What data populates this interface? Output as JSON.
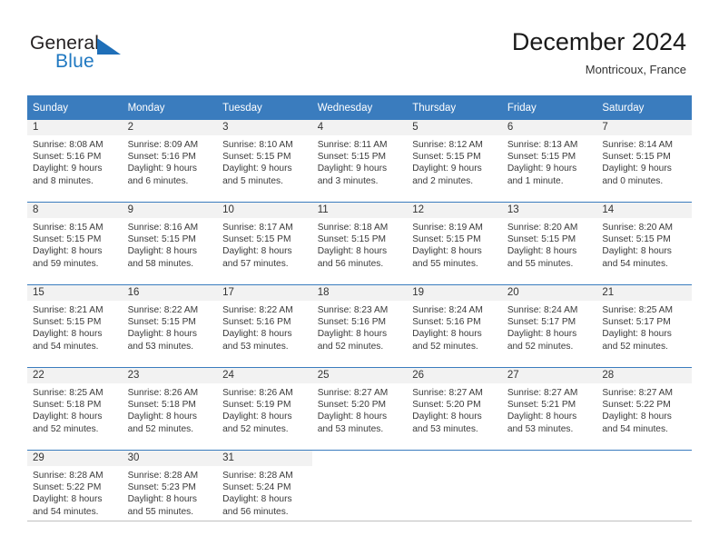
{
  "brand": {
    "name_part1": "General",
    "name_part2": "Blue",
    "mark": "triangle-logo-icon",
    "accent_color": "#1f78c1"
  },
  "header": {
    "month_title": "December 2024",
    "location": "Montricoux, France"
  },
  "theme": {
    "header_row_bg": "#3a7cbe",
    "daynum_band_bg": "#f2f2f2",
    "rule_color": "#3a7cbe"
  },
  "weekday_headers": [
    "Sunday",
    "Monday",
    "Tuesday",
    "Wednesday",
    "Thursday",
    "Friday",
    "Saturday"
  ],
  "weeks": [
    [
      {
        "day": "1",
        "sunrise": "Sunrise: 8:08 AM",
        "sunset": "Sunset: 5:16 PM",
        "daylight1": "Daylight: 9 hours",
        "daylight2": "and 8 minutes."
      },
      {
        "day": "2",
        "sunrise": "Sunrise: 8:09 AM",
        "sunset": "Sunset: 5:16 PM",
        "daylight1": "Daylight: 9 hours",
        "daylight2": "and 6 minutes."
      },
      {
        "day": "3",
        "sunrise": "Sunrise: 8:10 AM",
        "sunset": "Sunset: 5:15 PM",
        "daylight1": "Daylight: 9 hours",
        "daylight2": "and 5 minutes."
      },
      {
        "day": "4",
        "sunrise": "Sunrise: 8:11 AM",
        "sunset": "Sunset: 5:15 PM",
        "daylight1": "Daylight: 9 hours",
        "daylight2": "and 3 minutes."
      },
      {
        "day": "5",
        "sunrise": "Sunrise: 8:12 AM",
        "sunset": "Sunset: 5:15 PM",
        "daylight1": "Daylight: 9 hours",
        "daylight2": "and 2 minutes."
      },
      {
        "day": "6",
        "sunrise": "Sunrise: 8:13 AM",
        "sunset": "Sunset: 5:15 PM",
        "daylight1": "Daylight: 9 hours",
        "daylight2": "and 1 minute."
      },
      {
        "day": "7",
        "sunrise": "Sunrise: 8:14 AM",
        "sunset": "Sunset: 5:15 PM",
        "daylight1": "Daylight: 9 hours",
        "daylight2": "and 0 minutes."
      }
    ],
    [
      {
        "day": "8",
        "sunrise": "Sunrise: 8:15 AM",
        "sunset": "Sunset: 5:15 PM",
        "daylight1": "Daylight: 8 hours",
        "daylight2": "and 59 minutes."
      },
      {
        "day": "9",
        "sunrise": "Sunrise: 8:16 AM",
        "sunset": "Sunset: 5:15 PM",
        "daylight1": "Daylight: 8 hours",
        "daylight2": "and 58 minutes."
      },
      {
        "day": "10",
        "sunrise": "Sunrise: 8:17 AM",
        "sunset": "Sunset: 5:15 PM",
        "daylight1": "Daylight: 8 hours",
        "daylight2": "and 57 minutes."
      },
      {
        "day": "11",
        "sunrise": "Sunrise: 8:18 AM",
        "sunset": "Sunset: 5:15 PM",
        "daylight1": "Daylight: 8 hours",
        "daylight2": "and 56 minutes."
      },
      {
        "day": "12",
        "sunrise": "Sunrise: 8:19 AM",
        "sunset": "Sunset: 5:15 PM",
        "daylight1": "Daylight: 8 hours",
        "daylight2": "and 55 minutes."
      },
      {
        "day": "13",
        "sunrise": "Sunrise: 8:20 AM",
        "sunset": "Sunset: 5:15 PM",
        "daylight1": "Daylight: 8 hours",
        "daylight2": "and 55 minutes."
      },
      {
        "day": "14",
        "sunrise": "Sunrise: 8:20 AM",
        "sunset": "Sunset: 5:15 PM",
        "daylight1": "Daylight: 8 hours",
        "daylight2": "and 54 minutes."
      }
    ],
    [
      {
        "day": "15",
        "sunrise": "Sunrise: 8:21 AM",
        "sunset": "Sunset: 5:15 PM",
        "daylight1": "Daylight: 8 hours",
        "daylight2": "and 54 minutes."
      },
      {
        "day": "16",
        "sunrise": "Sunrise: 8:22 AM",
        "sunset": "Sunset: 5:15 PM",
        "daylight1": "Daylight: 8 hours",
        "daylight2": "and 53 minutes."
      },
      {
        "day": "17",
        "sunrise": "Sunrise: 8:22 AM",
        "sunset": "Sunset: 5:16 PM",
        "daylight1": "Daylight: 8 hours",
        "daylight2": "and 53 minutes."
      },
      {
        "day": "18",
        "sunrise": "Sunrise: 8:23 AM",
        "sunset": "Sunset: 5:16 PM",
        "daylight1": "Daylight: 8 hours",
        "daylight2": "and 52 minutes."
      },
      {
        "day": "19",
        "sunrise": "Sunrise: 8:24 AM",
        "sunset": "Sunset: 5:16 PM",
        "daylight1": "Daylight: 8 hours",
        "daylight2": "and 52 minutes."
      },
      {
        "day": "20",
        "sunrise": "Sunrise: 8:24 AM",
        "sunset": "Sunset: 5:17 PM",
        "daylight1": "Daylight: 8 hours",
        "daylight2": "and 52 minutes."
      },
      {
        "day": "21",
        "sunrise": "Sunrise: 8:25 AM",
        "sunset": "Sunset: 5:17 PM",
        "daylight1": "Daylight: 8 hours",
        "daylight2": "and 52 minutes."
      }
    ],
    [
      {
        "day": "22",
        "sunrise": "Sunrise: 8:25 AM",
        "sunset": "Sunset: 5:18 PM",
        "daylight1": "Daylight: 8 hours",
        "daylight2": "and 52 minutes."
      },
      {
        "day": "23",
        "sunrise": "Sunrise: 8:26 AM",
        "sunset": "Sunset: 5:18 PM",
        "daylight1": "Daylight: 8 hours",
        "daylight2": "and 52 minutes."
      },
      {
        "day": "24",
        "sunrise": "Sunrise: 8:26 AM",
        "sunset": "Sunset: 5:19 PM",
        "daylight1": "Daylight: 8 hours",
        "daylight2": "and 52 minutes."
      },
      {
        "day": "25",
        "sunrise": "Sunrise: 8:27 AM",
        "sunset": "Sunset: 5:20 PM",
        "daylight1": "Daylight: 8 hours",
        "daylight2": "and 53 minutes."
      },
      {
        "day": "26",
        "sunrise": "Sunrise: 8:27 AM",
        "sunset": "Sunset: 5:20 PM",
        "daylight1": "Daylight: 8 hours",
        "daylight2": "and 53 minutes."
      },
      {
        "day": "27",
        "sunrise": "Sunrise: 8:27 AM",
        "sunset": "Sunset: 5:21 PM",
        "daylight1": "Daylight: 8 hours",
        "daylight2": "and 53 minutes."
      },
      {
        "day": "28",
        "sunrise": "Sunrise: 8:27 AM",
        "sunset": "Sunset: 5:22 PM",
        "daylight1": "Daylight: 8 hours",
        "daylight2": "and 54 minutes."
      }
    ],
    [
      {
        "day": "29",
        "sunrise": "Sunrise: 8:28 AM",
        "sunset": "Sunset: 5:22 PM",
        "daylight1": "Daylight: 8 hours",
        "daylight2": "and 54 minutes."
      },
      {
        "day": "30",
        "sunrise": "Sunrise: 8:28 AM",
        "sunset": "Sunset: 5:23 PM",
        "daylight1": "Daylight: 8 hours",
        "daylight2": "and 55 minutes."
      },
      {
        "day": "31",
        "sunrise": "Sunrise: 8:28 AM",
        "sunset": "Sunset: 5:24 PM",
        "daylight1": "Daylight: 8 hours",
        "daylight2": "and 56 minutes."
      },
      {
        "day": "",
        "sunrise": "",
        "sunset": "",
        "daylight1": "",
        "daylight2": ""
      },
      {
        "day": "",
        "sunrise": "",
        "sunset": "",
        "daylight1": "",
        "daylight2": ""
      },
      {
        "day": "",
        "sunrise": "",
        "sunset": "",
        "daylight1": "",
        "daylight2": ""
      },
      {
        "day": "",
        "sunrise": "",
        "sunset": "",
        "daylight1": "",
        "daylight2": ""
      }
    ]
  ]
}
